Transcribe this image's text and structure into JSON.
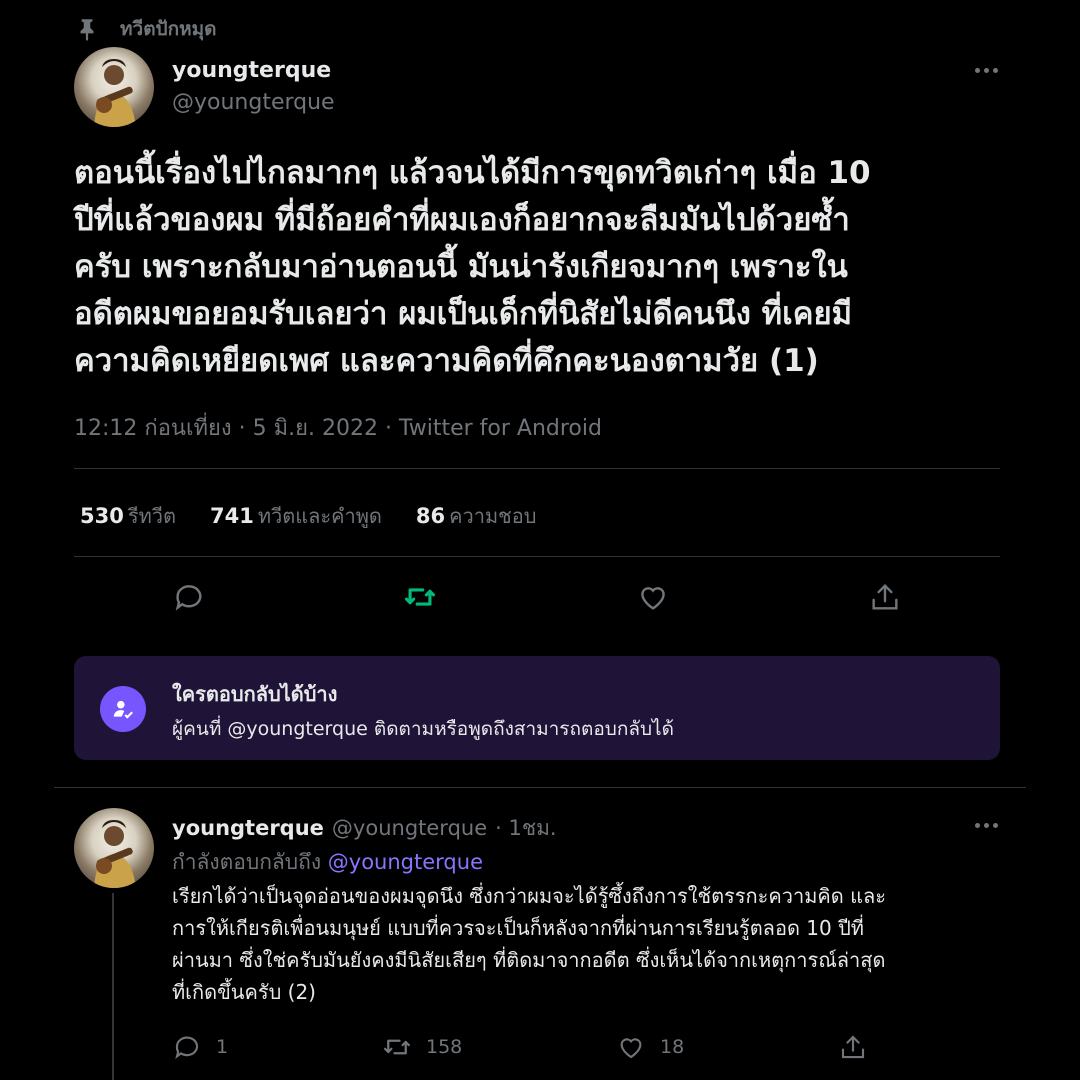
{
  "pinned": {
    "label": "ทวีตปักหมุด",
    "icon": "pin-icon"
  },
  "tweet": {
    "display_name": "youngterque",
    "handle": "@youngterque",
    "text_lines": [
      "ตอนนี้เรื่องไปไกลมากๆ แล้วจนได้มีการขุดทวิตเก่าๆ เมื่อ 10",
      "ปีที่แล้วของผม ที่มีถ้อยคำที่ผมเองก็อยากจะลืมมันไปด้วยซ้ำ",
      "ครับ เพราะกลับมาอ่านตอนนี้ มันน่ารังเกียจมากๆ เพราะใน",
      "อดีตผมขอยอมรับเลยว่า ผมเป็นเด็กที่นิสัยไม่ดีคนนึง ที่เคยมี",
      "ความคิดเหยียดเพศ และความคิดที่คึกคะนองตามวัย (1)"
    ],
    "meta": "12:12 ก่อนเที่ยง · 5 มิ.ย. 2022 · Twitter for Android",
    "stats": {
      "retweets_count": "530",
      "retweets_label": "รีทวีต",
      "quotes_count": "741",
      "quotes_label": "ทวีตและคำพูด",
      "likes_count": "86",
      "likes_label": "ความชอบ"
    }
  },
  "reply_notice": {
    "title": "ใครตอบกลับได้บ้าง",
    "description": "ผู้คนที่ @youngterque ติดตามหรือพูดถึงสามารถตอบกลับได้"
  },
  "reply": {
    "display_name": "youngterque",
    "handle": "@youngterque",
    "time": "· 1ชม.",
    "replying_prefix": "กำลังตอบกลับถึง",
    "replying_to": "@youngterque",
    "text_lines": [
      "เรียกได้ว่าเป็นจุดอ่อนของผมจุดนึง ซึ่งกว่าผมจะได้รู้ซึ้งถึงการใช้ตรรกะความคิด และ",
      "การให้เกียรติเพื่อนมนุษย์ แบบที่ควรจะเป็นก็หลังจากที่ผ่านการเรียนรู้ตลอด 10 ปีที่",
      "ผ่านมา ซึ่งใช่ครับมันยังคงมีนิสัยเสียๆ ที่ติดมาจากอดีต ซึ่งเห็นได้จากเหตุการณ์ล่าสุด",
      "ที่เกิดขึ้นครับ (2)"
    ],
    "counts": {
      "replies": "1",
      "retweets": "158",
      "likes": "18"
    }
  },
  "colors": {
    "background": "#000000",
    "text": "#e7e9ea",
    "muted": "#71767b",
    "retweet_green": "#00ba7c",
    "accent_purple": "#7856ff",
    "notice_bg": "#1f1438"
  }
}
